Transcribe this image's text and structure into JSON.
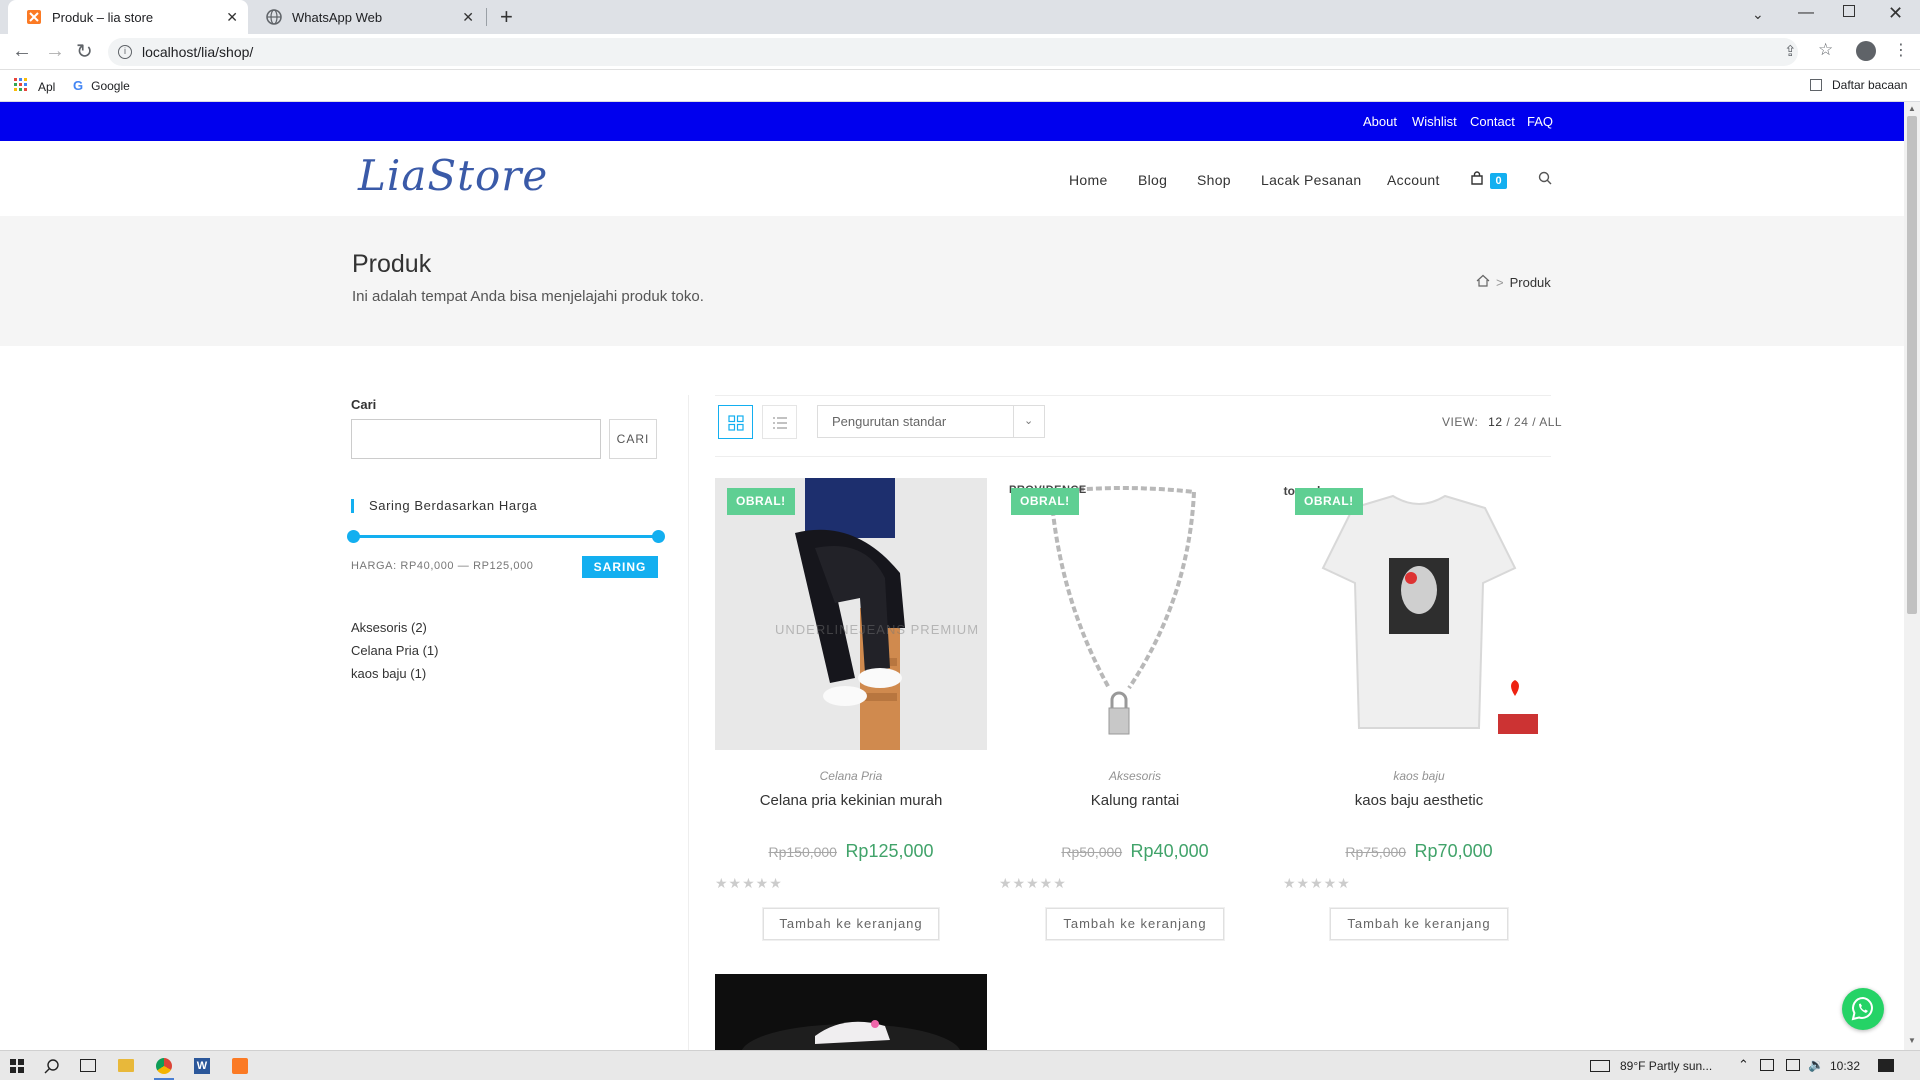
{
  "browser": {
    "tabs": [
      {
        "title": "Produk – lia store"
      },
      {
        "title": "WhatsApp Web"
      }
    ],
    "url": "localhost/lia/shop/",
    "bookmarks": [
      {
        "label": "Apl"
      },
      {
        "label": "Google"
      }
    ],
    "reading_list": "Daftar bacaan"
  },
  "topbar": {
    "links": [
      "About",
      "Wishlist",
      "Contact",
      "FAQ"
    ]
  },
  "header": {
    "logo_text": "LiaStore",
    "nav": [
      "Home",
      "Blog",
      "Shop",
      "Lacak Pesanan",
      "Account"
    ],
    "cart_count": "0"
  },
  "page_title": {
    "title": "Produk",
    "subtitle": "Ini adalah tempat Anda bisa menjelajahi produk toko.",
    "breadcrumb_current": "Produk",
    "breadcrumb_sep": ">"
  },
  "sidebar": {
    "search_label": "Cari",
    "search_value": "",
    "search_button": "CARI",
    "price_filter_title": "Saring Berdasarkan Harga",
    "price_range_text": "HARGA: RP40,000 — RP125,000",
    "filter_button": "SARING",
    "categories": [
      {
        "name": "Aksesoris",
        "count": "(2)"
      },
      {
        "name": "Celana Pria",
        "count": "(1)"
      },
      {
        "name": "kaos baju",
        "count": "(1)"
      }
    ]
  },
  "toolbar": {
    "sort_selected": "Pengurutan standar",
    "view_label": "VIEW:",
    "view_options": [
      "12",
      "24",
      "ALL"
    ],
    "view_sep": "/"
  },
  "products": [
    {
      "badge": "OBRAL!",
      "category": "Celana Pria",
      "name": "Celana pria kekinian murah",
      "old_price": "Rp150,000",
      "price": "Rp125,000",
      "button": "Tambah ke keranjang",
      "watermark": "UNDERLINEJEANS PREMIUM"
    },
    {
      "badge": "OBRAL!",
      "category": "Aksesoris",
      "name": "Kalung rantai",
      "old_price": "Rp50,000",
      "price": "Rp40,000",
      "button": "Tambah ke keranjang",
      "watermark": "PROVIDENCE"
    },
    {
      "badge": "OBRAL!",
      "category": "kaos baju",
      "name": "kaos baju aesthetic",
      "old_price": "Rp75,000",
      "price": "Rp70,000",
      "button": "Tambah ke keranjang",
      "watermark": "storeed"
    }
  ],
  "taskbar": {
    "weather": "89°F  Partly sun...",
    "time": "10:32"
  },
  "colors": {
    "topbar": "#0000ee",
    "accent": "#13aff0",
    "sale_badge": "#5fcf93",
    "price": "#41a36a"
  }
}
